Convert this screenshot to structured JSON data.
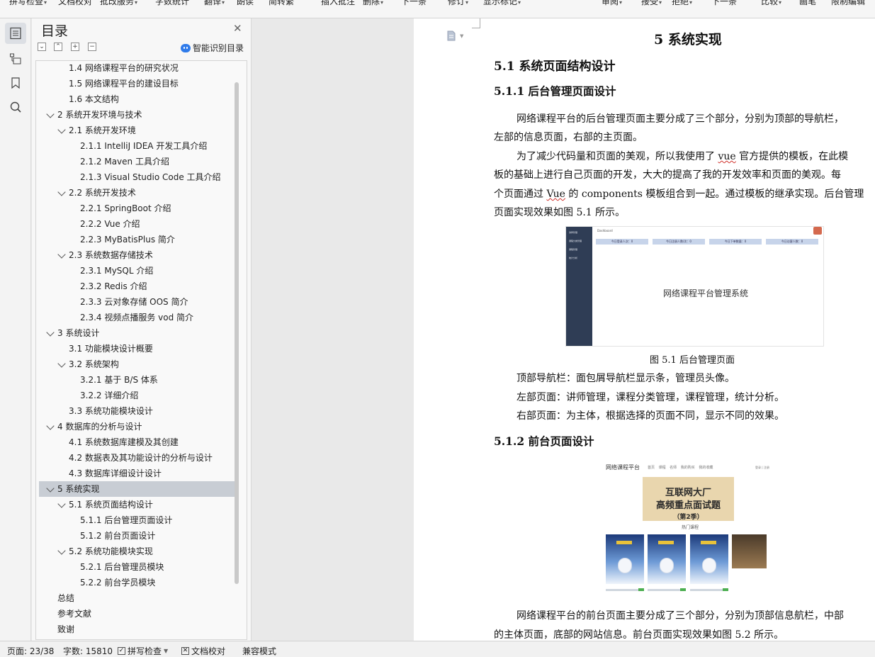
{
  "toolbar": {
    "items": [
      {
        "label": "拼写检查",
        "has_dropdown": true
      },
      {
        "label": "文档校对",
        "has_dropdown": false
      },
      {
        "label": "批改服务",
        "has_dropdown": true
      },
      {
        "label": "字数统计",
        "has_dropdown": false
      },
      {
        "label": "翻译",
        "has_dropdown": true
      },
      {
        "label": "朗读",
        "has_dropdown": false
      },
      {
        "label": "简转繁",
        "has_dropdown": false
      },
      {
        "label": "插入批注",
        "has_dropdown": false
      },
      {
        "label": "删除",
        "has_dropdown": true
      },
      {
        "label": "下一条",
        "has_dropdown": false
      },
      {
        "label": "修订",
        "has_dropdown": true
      },
      {
        "label": "显示标记",
        "has_dropdown": true
      },
      {
        "label": "审阅",
        "has_dropdown": true
      },
      {
        "label": "接受",
        "has_dropdown": true
      },
      {
        "label": "拒绝",
        "has_dropdown": true
      },
      {
        "label": "下一条",
        "has_dropdown": false
      },
      {
        "label": "比较",
        "has_dropdown": true
      },
      {
        "label": "画笔",
        "has_dropdown": false
      },
      {
        "label": "限制编辑",
        "has_dropdown": false
      }
    ]
  },
  "sidebar_icons": [
    "toc-icon",
    "outline-icon",
    "bookmark-icon",
    "search-icon"
  ],
  "toc_panel": {
    "title": "目录",
    "close_icon": "close-icon",
    "controls": [
      "collapse-all-icon",
      "expand-level-icon",
      "add-item-icon",
      "remove-item-icon"
    ],
    "smart_label": "智能识别目录",
    "items": [
      {
        "text": "1.4  网络课程平台的研究状况",
        "level": 2,
        "expandable": false,
        "selected": false
      },
      {
        "text": "1.5  网络课程平台的建设目标",
        "level": 2,
        "expandable": false,
        "selected": false
      },
      {
        "text": "1.6  本文结构",
        "level": 2,
        "expandable": false,
        "selected": false
      },
      {
        "text": "2  系统开发环境与技术",
        "level": 1,
        "expandable": true,
        "selected": false
      },
      {
        "text": "2.1  系统开发环境",
        "level": 2,
        "expandable": true,
        "selected": false
      },
      {
        "text": "2.1.1 IntelliJ IDEA  开发工具介绍",
        "level": 3,
        "expandable": false,
        "selected": false
      },
      {
        "text": "2.1.2 Maven 工具介绍",
        "level": 3,
        "expandable": false,
        "selected": false
      },
      {
        "text": "2.1.3 Visual Studio Code 工具介绍",
        "level": 3,
        "expandable": false,
        "selected": false
      },
      {
        "text": "2.2  系统开发技术",
        "level": 2,
        "expandable": true,
        "selected": false
      },
      {
        "text": "2.2.1 SpringBoot 介绍",
        "level": 3,
        "expandable": false,
        "selected": false
      },
      {
        "text": "2.2.2 Vue 介绍",
        "level": 3,
        "expandable": false,
        "selected": false
      },
      {
        "text": "2.2.3 MyBatisPlus 简介",
        "level": 3,
        "expandable": false,
        "selected": false
      },
      {
        "text": "2.3  系统数据存储技术",
        "level": 2,
        "expandable": true,
        "selected": false
      },
      {
        "text": "2.3.1 MySQL 介绍",
        "level": 3,
        "expandable": false,
        "selected": false
      },
      {
        "text": "2.3.2 Redis 介绍",
        "level": 3,
        "expandable": false,
        "selected": false
      },
      {
        "text": "2.3.3  云对象存储 OOS 简介",
        "level": 3,
        "expandable": false,
        "selected": false
      },
      {
        "text": "2.3.4  视频点播服务 vod 简介",
        "level": 3,
        "expandable": false,
        "selected": false
      },
      {
        "text": "3  系统设计",
        "level": 1,
        "expandable": true,
        "selected": false
      },
      {
        "text": "3.1  功能模块设计概要",
        "level": 2,
        "expandable": false,
        "selected": false
      },
      {
        "text": "3.2  系统架构",
        "level": 2,
        "expandable": true,
        "selected": false
      },
      {
        "text": "3.2.1  基于 B/S 体系",
        "level": 3,
        "expandable": false,
        "selected": false
      },
      {
        "text": "3.2.2  详细介绍",
        "level": 3,
        "expandable": false,
        "selected": false
      },
      {
        "text": "3.3  系统功能模块设计",
        "level": 2,
        "expandable": false,
        "selected": false
      },
      {
        "text": "4  数据库的分析与设计",
        "level": 1,
        "expandable": true,
        "selected": false
      },
      {
        "text": "4.1  系统数据库建模及其创建",
        "level": 2,
        "expandable": false,
        "selected": false
      },
      {
        "text": "4.2  数据表及其功能设计的分析与设计",
        "level": 2,
        "expandable": false,
        "selected": false
      },
      {
        "text": "4.3  数据库详细设计设计",
        "level": 2,
        "expandable": false,
        "selected": false
      },
      {
        "text": "5  系统实现",
        "level": 1,
        "expandable": true,
        "selected": true
      },
      {
        "text": "5.1  系统页面结构设计",
        "level": 2,
        "expandable": true,
        "selected": false
      },
      {
        "text": "5.1.1  后台管理页面设计",
        "level": 3,
        "expandable": false,
        "selected": false
      },
      {
        "text": "5.1.2 前台页面设计",
        "level": 3,
        "expandable": false,
        "selected": false
      },
      {
        "text": "5.2  系统功能模块实现",
        "level": 2,
        "expandable": true,
        "selected": false
      },
      {
        "text": "5.2.1  后台管理员模块",
        "level": 3,
        "expandable": false,
        "selected": false
      },
      {
        "text": "5.2.2  前台学员模块",
        "level": 3,
        "expandable": false,
        "selected": false
      },
      {
        "text": "总结",
        "level": 0,
        "expandable": false,
        "selected": false
      },
      {
        "text": "参考文献",
        "level": 0,
        "expandable": false,
        "selected": false
      },
      {
        "text": "致谢",
        "level": 0,
        "expandable": false,
        "selected": false
      }
    ]
  },
  "document": {
    "page_icon": "page-view-icon",
    "heading_chapter": "5  系统实现",
    "heading_5_1": "5.1  系统页面结构设计",
    "heading_5_1_1": "5.1.1  后台管理页面设计",
    "para1_line1": "网络课程平台的后台管理页面主要分成了三个部分，分别为顶部的导航栏，",
    "para1_line2": "左部的信息页面，右部的主页面。",
    "para2_line1_a": "为了减少代码量和页面的美观，所以我使用了 ",
    "para2_line1_b": "vue",
    "para2_line1_c": " 官方提供的模板，在此模",
    "para2_line2": "板的基础上进行自己页面的开发，大大的提高了我的开发效率和页面的美观。每",
    "para2_line3_a": "个页面通过 ",
    "para2_line3_b": "Vue",
    "para2_line3_c": " 的 components 模板组合到一起。通过模板的继承实现。后台管理",
    "para2_line4": "页面实现效果如图 5.1 所示。",
    "figure1": {
      "menu_items": [
        "讲师管理",
        "课程分类管理",
        "课程管理",
        "统计分析"
      ],
      "breadcrumb": "Dashboard",
      "cards": [
        "今日登录人次：0",
        "今日注册人数/次：0",
        "今日下单数量：0",
        "今日访客人数：0"
      ],
      "main_text": "网络课程平台管理系统"
    },
    "figure1_caption": "图 5.1  后台管理页面",
    "desc_top": "顶部导航栏：面包屑导航栏显示条，管理员头像。",
    "desc_left": "左部页面：讲师管理，课程分类管理，课程管理，统计分析。",
    "desc_right": "右部页面：为主体，根据选择的页面不同，显示不同的效果。",
    "heading_5_1_2": "5.1.2 前台页面设计",
    "figure2": {
      "brand": "网络课程平台",
      "nav": "首页  课程  名师  我的购买  我的收藏",
      "login": "登录 | 注册",
      "banner_line1": "互联网大厂",
      "banner_line2": "高频重点面试题",
      "banner_line3": "（第2季）",
      "section_title": "热门课程"
    },
    "para3_line1": "网络课程平台的前台页面主要分成了三个部分，分别为顶部信息航栏，中部",
    "para3_line2": "的主体页面，底部的网站信息。前台页面实现效果如图 5.2 所示。"
  },
  "status_bar": {
    "page": "页面: 23/38",
    "words": "字数: 15810",
    "spell_check": "拼写检查",
    "proofread": "文档校对",
    "compat": "兼容模式"
  }
}
